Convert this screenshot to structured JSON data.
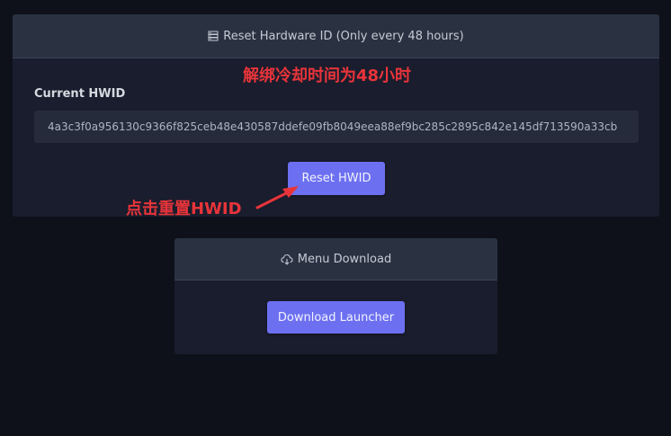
{
  "reset_card": {
    "header_title": "Reset Hardware ID (Only every 48 hours)",
    "header_icon": "server-icon",
    "cooldown_annotation": "解绑冷却时间为48小时",
    "current_hwid_label": "Current HWID",
    "current_hwid_value": "4a3c3f0a956130c9366f825ceb48e430587ddefe09fb8049eea88ef9bc285c2895c842e145df713590a33cb",
    "reset_button_label": "Reset HWID",
    "click_annotation": "点击重置HWID"
  },
  "download_card": {
    "header_title": "Menu Download",
    "header_icon": "cloud-download-icon",
    "download_button_label": "Download Launcher"
  },
  "colors": {
    "page_bg": "#0f111a",
    "card_bg": "#1a1d2d",
    "header_bg": "#2a3242",
    "accent": "#6c70f0",
    "annotation_red": "#e8343a"
  }
}
